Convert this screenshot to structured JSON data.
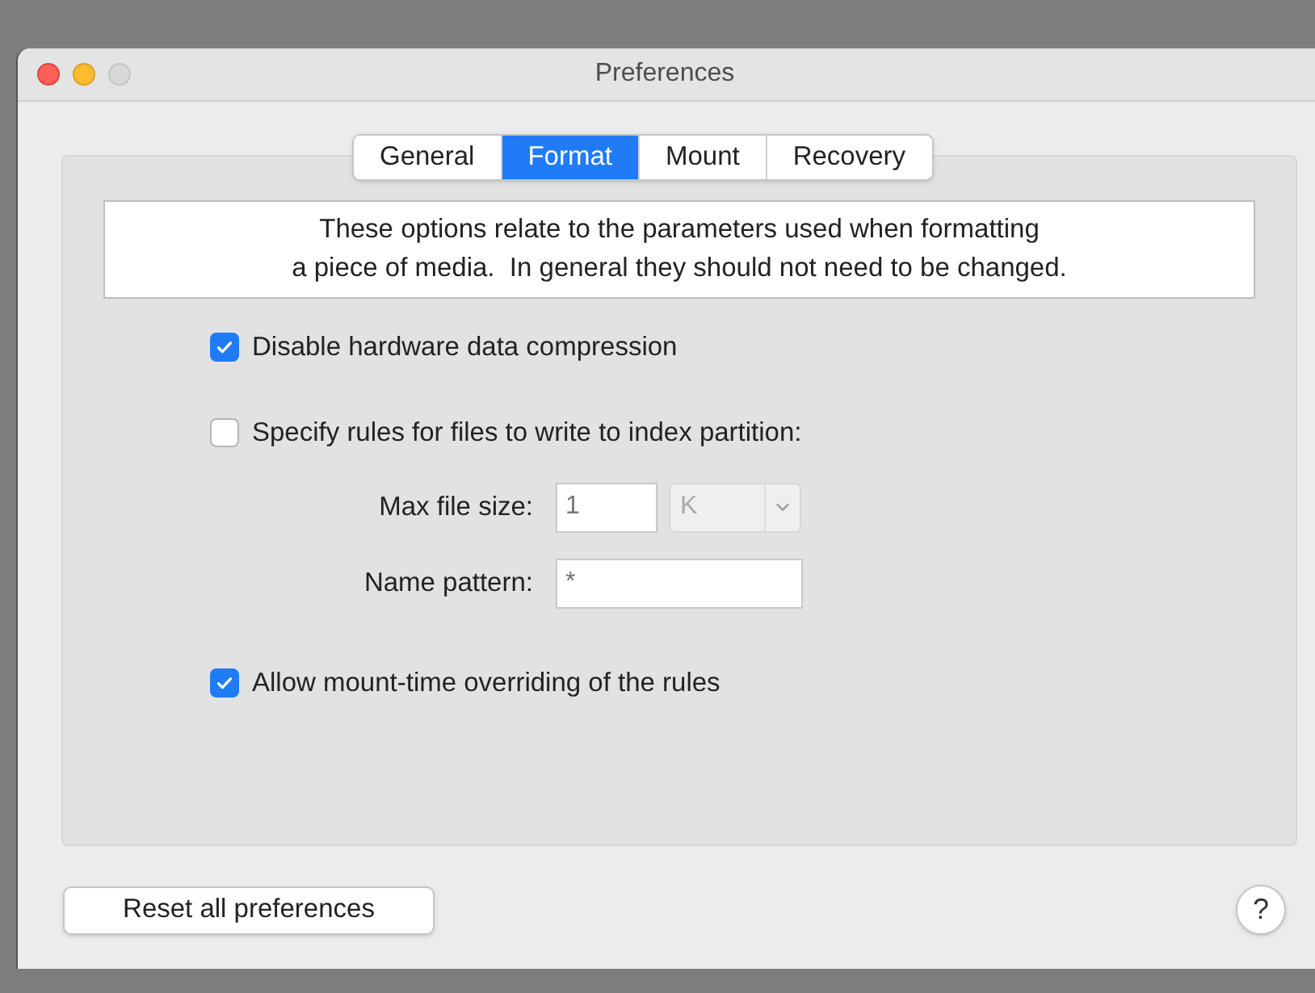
{
  "window": {
    "title": "Preferences"
  },
  "tabs": [
    {
      "label": "General",
      "selected": false
    },
    {
      "label": "Format",
      "selected": true
    },
    {
      "label": "Mount",
      "selected": false
    },
    {
      "label": "Recovery",
      "selected": false
    }
  ],
  "description": [
    "These options relate to the parameters used when formatting",
    "a piece of media.  In general they should not need to be changed."
  ],
  "options": [
    {
      "kind": "checkbox",
      "label": "Disable hardware data compression",
      "checked": true
    },
    {
      "kind": "checkbox",
      "label": "Specify rules for files to write to index partition:",
      "checked": false
    },
    {
      "kind": "size_field",
      "label": "Max file size:",
      "value": "1",
      "unit": "K",
      "disabled": true
    },
    {
      "kind": "text_field",
      "label": "Name pattern:",
      "value": "*",
      "disabled": true
    },
    {
      "kind": "checkbox",
      "label": "Allow mount-time overriding of the rules",
      "checked": true
    }
  ],
  "buttons": {
    "reset": "Reset all preferences",
    "help": "?"
  }
}
